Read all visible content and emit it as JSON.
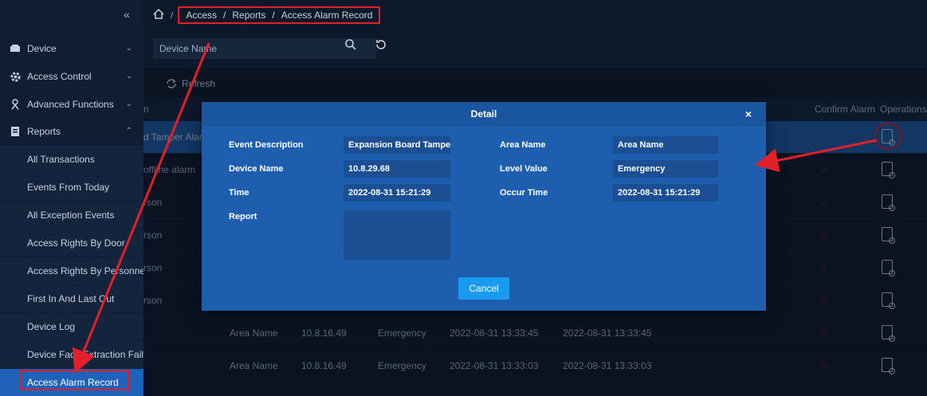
{
  "sidebar": {
    "collapse_icon": "«",
    "menus": [
      {
        "label": "Device",
        "icon": "device-icon",
        "chevron": "⌄"
      },
      {
        "label": "Access Control",
        "icon": "gear-icon",
        "chevron": "⌄"
      },
      {
        "label": "Advanced Functions",
        "icon": "person-gear-icon",
        "chevron": "⌄"
      },
      {
        "label": "Reports",
        "icon": "report-icon",
        "chevron": "⌃"
      }
    ],
    "report_items": [
      "All Transactions",
      "Events From Today",
      "All Exception Events",
      "Access Rights By Door",
      "Access Rights By Personnel",
      "First In And Last Out",
      "Device Log",
      "Device Face Extraction Fail",
      "Access Alarm Record"
    ]
  },
  "breadcrumb": {
    "home_icon": "home-icon",
    "items": [
      "Access",
      "Reports",
      "Access Alarm Record"
    ],
    "separator": "/"
  },
  "filter": {
    "device_name_placeholder": "Device Name"
  },
  "toolbar": {
    "refresh_label": "Refresh"
  },
  "table": {
    "headers": {
      "first": "n",
      "confirm_alarm": "Confirm Alarm",
      "operations": "Operations"
    },
    "rows": [
      {
        "first": "d Tamper Alar",
        "area": "",
        "ip": "",
        "level": "",
        "time": "",
        "occur": ""
      },
      {
        "first": "offline alarm",
        "area": "",
        "ip": "",
        "level": "",
        "time": "",
        "occur": ""
      },
      {
        "first": "rson",
        "area": "",
        "ip": "",
        "level": "",
        "time": "",
        "occur": ""
      },
      {
        "first": "rson",
        "area": "",
        "ip": "",
        "level": "",
        "time": "",
        "occur": ""
      },
      {
        "first": "rson",
        "area": "",
        "ip": "",
        "level": "",
        "time": "",
        "occur": ""
      },
      {
        "first": "rson",
        "area": "",
        "ip": "",
        "level": "",
        "time": "",
        "occur": ""
      },
      {
        "first": "",
        "area": "Area Name",
        "ip": "10.8.16.49",
        "level": "Emergency",
        "time": "2022-08-31 13:33:45",
        "occur": "2022-08-31 13:33:45"
      },
      {
        "first": "",
        "area": "Area Name",
        "ip": "10.8.16.49",
        "level": "Emergency",
        "time": "2022-08-31 13:33:03",
        "occur": "2022-08-31 13:33:03"
      }
    ]
  },
  "dialog": {
    "title": "Detail",
    "close": "×",
    "fields": {
      "event_description_label": "Event Description",
      "event_description_value": "Expansion Board Tamper A",
      "area_name_label": "Area Name",
      "area_name_value": "Area Name",
      "device_name_label": "Device Name",
      "device_name_value": "10.8.29.68",
      "level_value_label": "Level Value",
      "level_value_value": "Emergency",
      "time_label": "Time",
      "time_value": "2022-08-31 15:21:29",
      "occur_time_label": "Occur Time",
      "occur_time_value": "2022-08-31 15:21:29",
      "report_label": "Report"
    },
    "cancel_label": "Cancel"
  },
  "colors": {
    "accent": "#1e63b8",
    "annotation_red": "#e3202a",
    "dialog_bg": "#1d5fae",
    "cancel_button": "#1a9bf0"
  }
}
